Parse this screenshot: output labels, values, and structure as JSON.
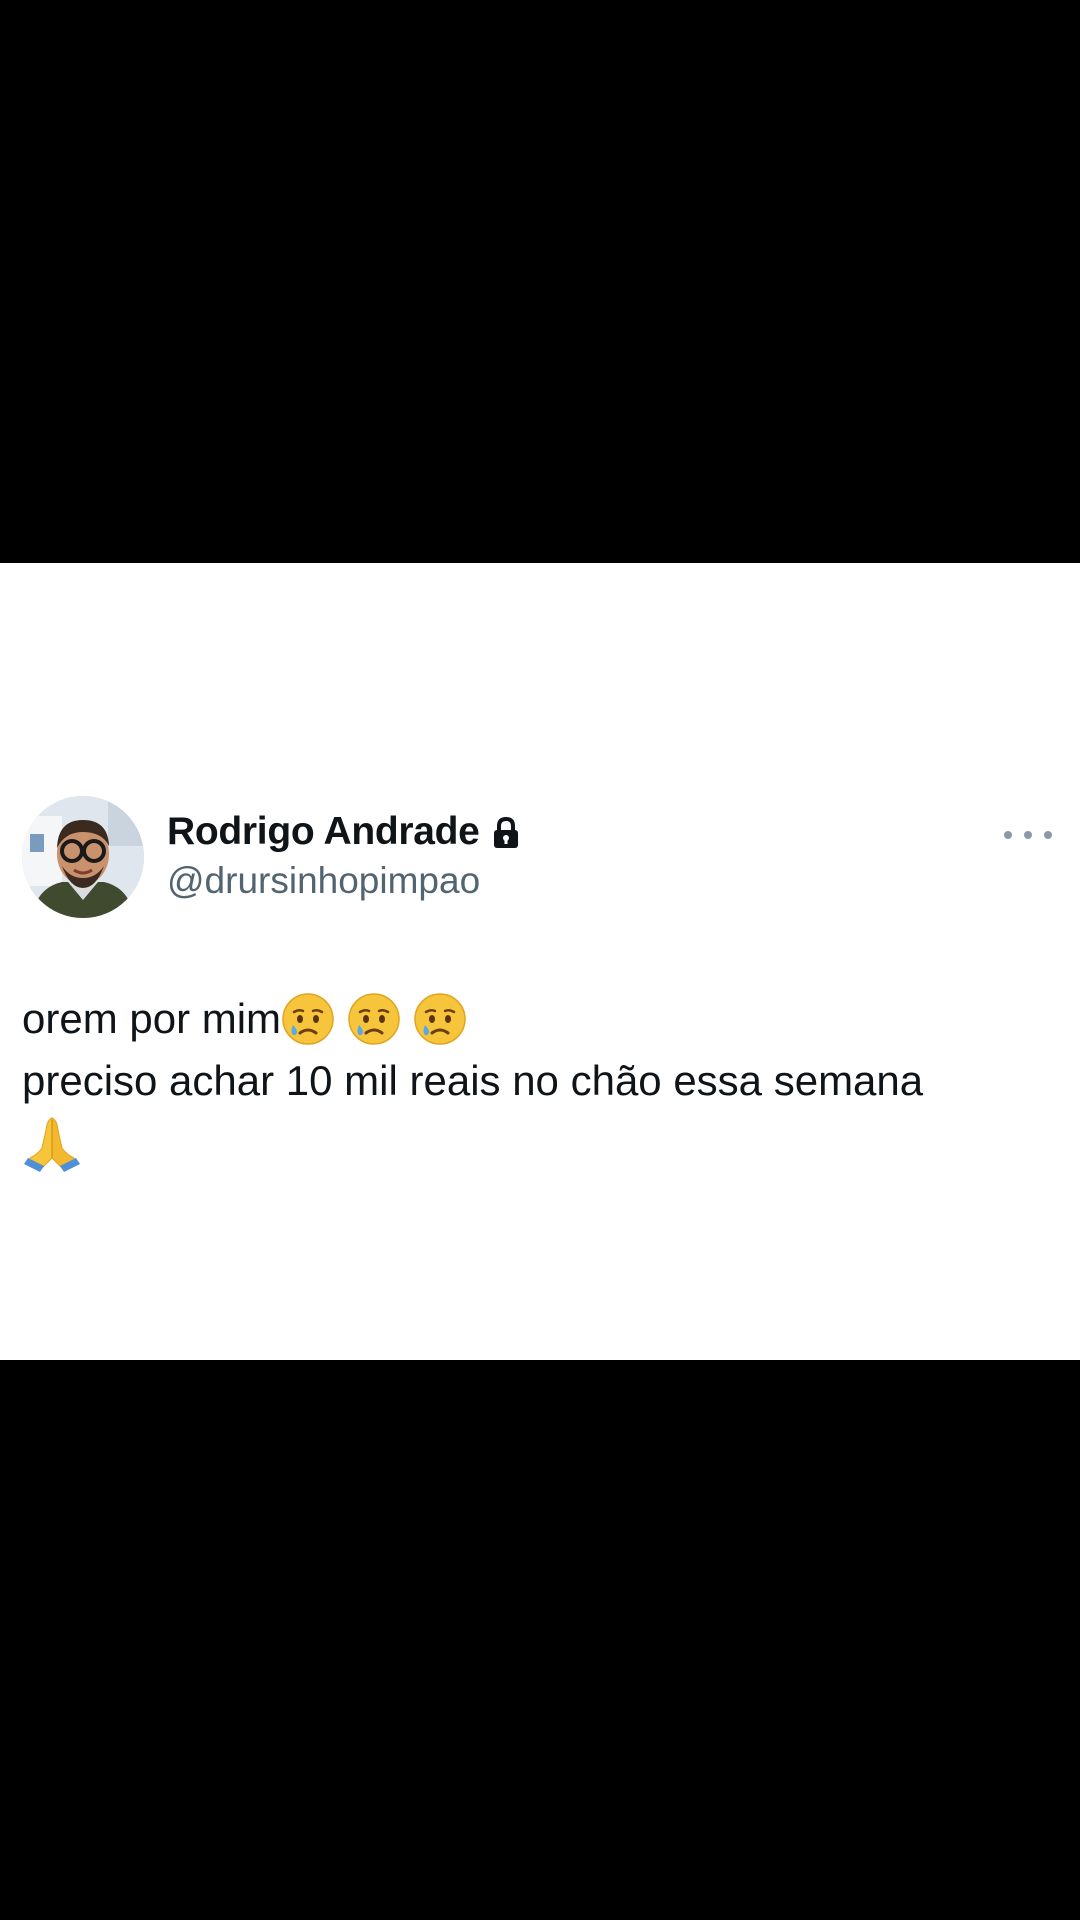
{
  "tweet": {
    "display_name": "Rodrigo Andrade",
    "handle": "@drursinhopimpao",
    "line1": "orem por mim",
    "line2": "preciso achar 10 mil reais no chão essa semana",
    "emoji_line1": [
      "sad-but-relieved-face",
      "sad-but-relieved-face",
      "sad-but-relieved-face"
    ],
    "emoji_line3": "folded-hands",
    "protected_icon": "lock-icon",
    "more_icon": "more-dots-icon"
  },
  "colors": {
    "name": "#0f1419",
    "handle": "#536471",
    "background": "#ffffff",
    "frame": "#000000"
  }
}
